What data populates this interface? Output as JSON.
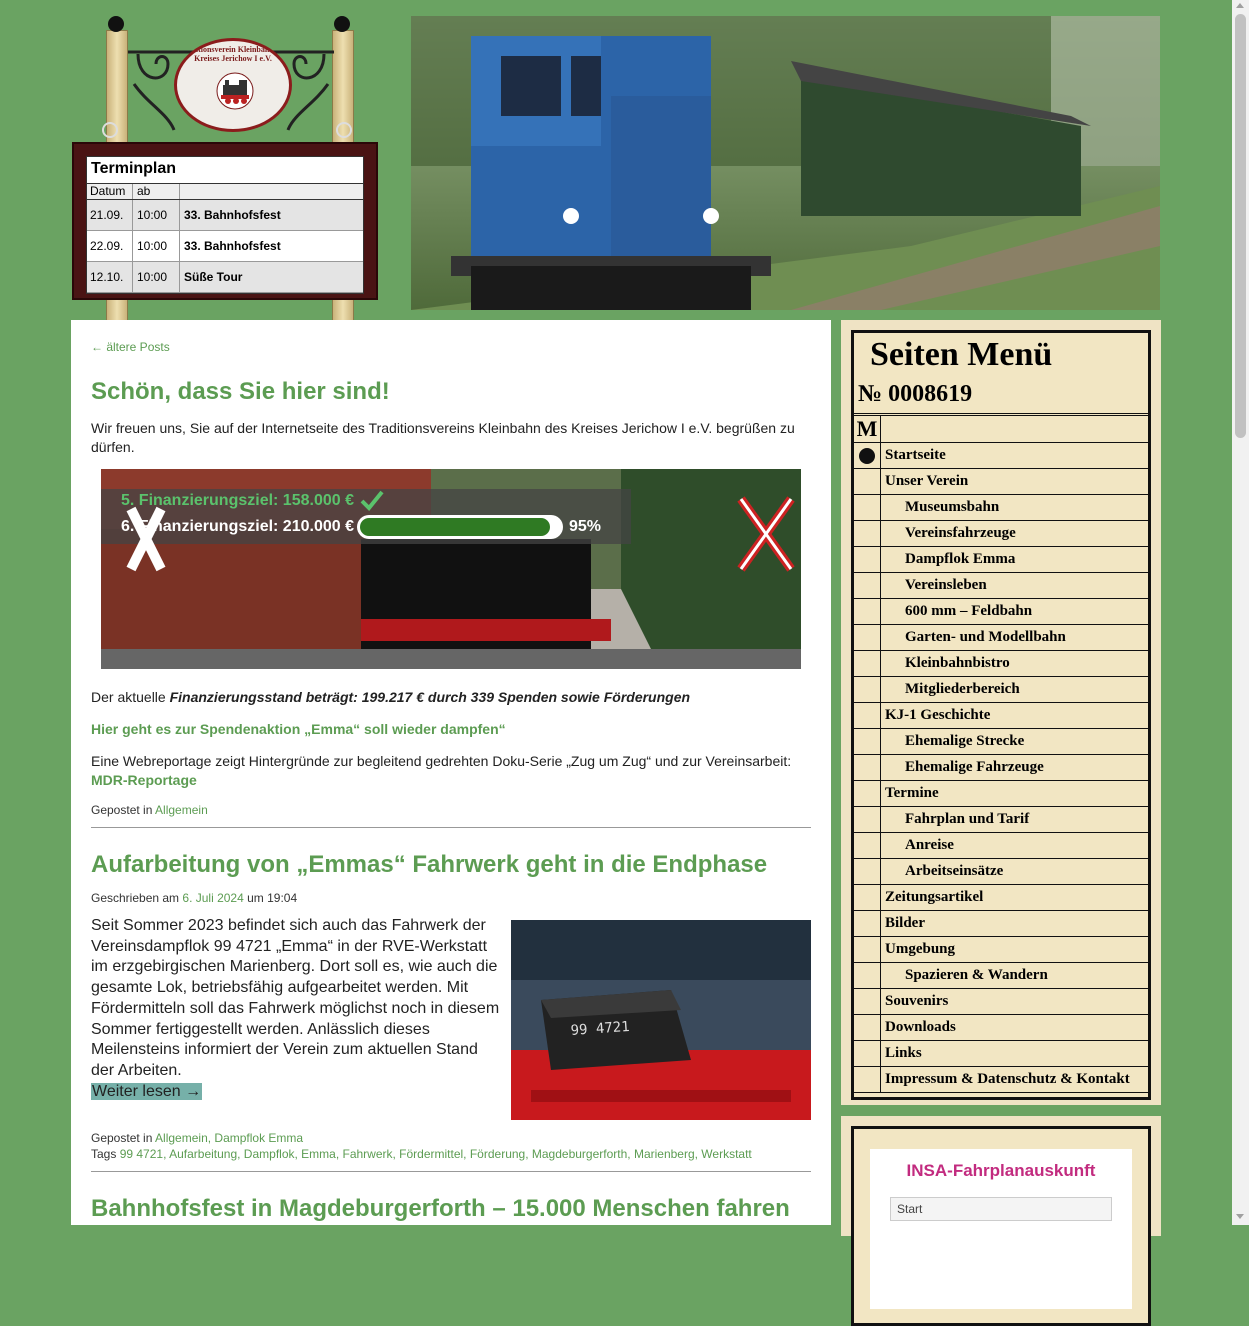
{
  "header": {
    "seal_text": "Traditionsverein Kleinbahn des Kreises Jerichow I e.V.",
    "schedule": {
      "title": "Terminplan",
      "col_date": "Datum",
      "col_from": "ab",
      "rows": [
        {
          "date": "21.09.",
          "time": "10:00",
          "event": "33. Bahnhofsfest"
        },
        {
          "date": "22.09.",
          "time": "10:00",
          "event": "33. Bahnhofsfest"
        },
        {
          "date": "12.10.",
          "time": "10:00",
          "event": "Süße Tour"
        }
      ]
    }
  },
  "main": {
    "older_posts": "← ältere Posts",
    "post1": {
      "title": "Schön, dass Sie hier sind!",
      "intro": "Wir freuen uns, Sie auf der Internetseite des Traditionsvereins Kleinbahn des Kreises Jerichow I e.V. begrüßen zu dürfen.",
      "goal5_label": "5. Finanzierungsziel: 158.000 €",
      "goal6_label": "6. Finanzierungsziel: 210.000 €",
      "goal6_progress": 0.95,
      "goal6_percent": "95%",
      "status_prefix": "Der aktuelle ",
      "status_text": "Finanzierungsstand beträgt: 199.217 € durch 339 Spenden sowie Förderungen",
      "donation_link": "Hier geht es zur Spendenaktion „Emma“ soll wieder dampfen“",
      "report_text": "Eine Webreportage zeigt Hintergründe zur begleitend gedrehten Doku-Serie „Zug um Zug“ und zur Vereinsarbeit:",
      "report_link": "MDR-Reportage",
      "posted_in": "Gepostet in",
      "category": "Allgemein"
    },
    "post2": {
      "title": "Aufarbeitung von „Emmas“ Fahrwerk geht in die Endphase",
      "written_on": "Geschrieben am",
      "date": "6. Juli 2024",
      "at_time": "um 19:04",
      "excerpt": "Seit Sommer 2023 befindet sich auch das Fahrwerk der Vereinsdampflok 99 4721 „Emma“ in der RVE-Werkstatt im erzgebirgischen Marienberg. Dort soll es, wie auch die gesamte Lok, betriebsfähig aufgearbeitet werden. Mit Fördermitteln soll das Fahrwerk möglichst noch in diesem Sommer fertiggestellt werden. Anlässlich dieses Meilensteins informiert der Verein zum aktuellen Stand der Arbeiten.",
      "read_more": "Weiter lesen →",
      "posted_in": "Gepostet in",
      "categories": "Allgemein, Dampflok Emma",
      "tags_label": "Tags",
      "tags": "99 4721, Aufarbeitung, Dampflok, Emma, Fahrwerk, Fördermittel, Förderung, Magdeburgerforth, Marienberg, Werkstatt",
      "plate_text": "99 4721"
    },
    "post3": {
      "title": "Bahnhofsfest in Magdeburgerforth – 15.000 Menschen fahren"
    }
  },
  "sidebar": {
    "title": "Seiten Menü",
    "number": "№ 0008619",
    "menu_head": "M",
    "items": [
      {
        "label": "Startseite",
        "sub": false,
        "active": true
      },
      {
        "label": "Unser Verein",
        "sub": false
      },
      {
        "label": "Museumsbahn",
        "sub": true
      },
      {
        "label": "Vereinsfahrzeuge",
        "sub": true
      },
      {
        "label": "Dampflok Emma",
        "sub": true
      },
      {
        "label": "Vereinsleben",
        "sub": true
      },
      {
        "label": "600 mm – Feldbahn",
        "sub": true
      },
      {
        "label": "Garten- und Modellbahn",
        "sub": true
      },
      {
        "label": "Kleinbahnbistro",
        "sub": true
      },
      {
        "label": "Mitgliederbereich",
        "sub": true
      },
      {
        "label": "KJ-1 Geschichte",
        "sub": false
      },
      {
        "label": "Ehemalige Strecke",
        "sub": true
      },
      {
        "label": "Ehemalige Fahrzeuge",
        "sub": true
      },
      {
        "label": "Termine",
        "sub": false
      },
      {
        "label": "Fahrplan und Tarif",
        "sub": true
      },
      {
        "label": "Anreise",
        "sub": true
      },
      {
        "label": "Arbeitseinsätze",
        "sub": true
      },
      {
        "label": "Zeitungsartikel",
        "sub": false
      },
      {
        "label": "Bilder",
        "sub": false
      },
      {
        "label": "Umgebung",
        "sub": false
      },
      {
        "label": "Spazieren & Wandern",
        "sub": true
      },
      {
        "label": "Souvenirs",
        "sub": false
      },
      {
        "label": "Downloads",
        "sub": false
      },
      {
        "label": "Links",
        "sub": false
      },
      {
        "label": "Impressum & Datenschutz & Kontakt",
        "sub": false
      }
    ],
    "insa_title": "INSA-Fahrplanauskunft",
    "insa_start_placeholder": "Start"
  },
  "colors": {
    "green": "#5c9c52",
    "background": "#6aa362",
    "insa": "#c22b7f"
  }
}
